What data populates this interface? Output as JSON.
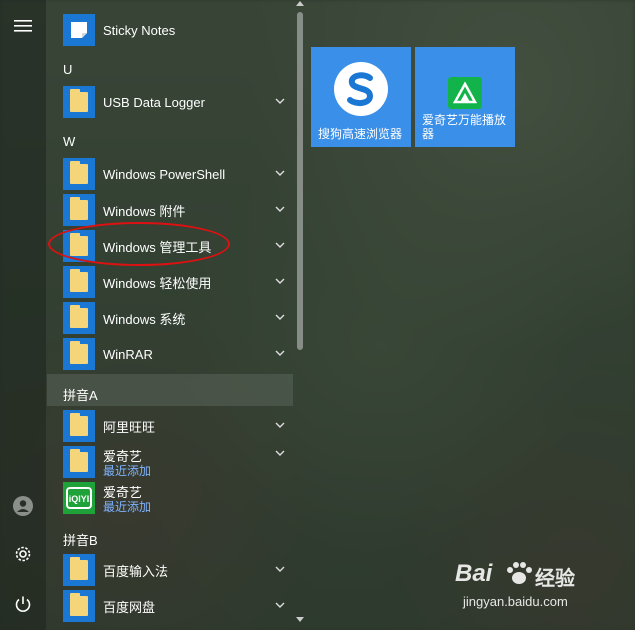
{
  "rail": {
    "menu_icon": "hamburger-menu-icon",
    "user_icon": "user-avatar-icon",
    "settings_icon": "gear-icon",
    "power_icon": "power-icon"
  },
  "apps": {
    "sticky_notes": "Sticky Notes",
    "group_u": "U",
    "usb_logger": "USB Data Logger",
    "group_w": "W",
    "powershell": "Windows PowerShell",
    "accessories": "Windows 附件",
    "admin_tools": "Windows 管理工具",
    "ease_access": "Windows 轻松使用",
    "system": "Windows 系统",
    "winrar": "WinRAR",
    "group_pinyin_a": "拼音A",
    "aliwangwang": "阿里旺旺",
    "iqiyi_folder": "爱奇艺",
    "iqiyi_folder_sub": "最近添加",
    "iqiyi_app": "爱奇艺",
    "iqiyi_app_sub": "最近添加",
    "group_pinyin_b": "拼音B",
    "baidu_ime": "百度输入法",
    "baidu_pan": "百度网盘"
  },
  "tiles": {
    "sogou": "搜狗高速浏览器",
    "iqiyi_player": "爱奇艺万能播放器"
  },
  "colors": {
    "accent": "#1a77d4",
    "tile": "#3a8fe8",
    "highlight_ellipse": "#dd1111"
  },
  "watermark": {
    "brand": "Bai",
    "brand2": "经验",
    "url": "jingyan.baidu.com"
  }
}
